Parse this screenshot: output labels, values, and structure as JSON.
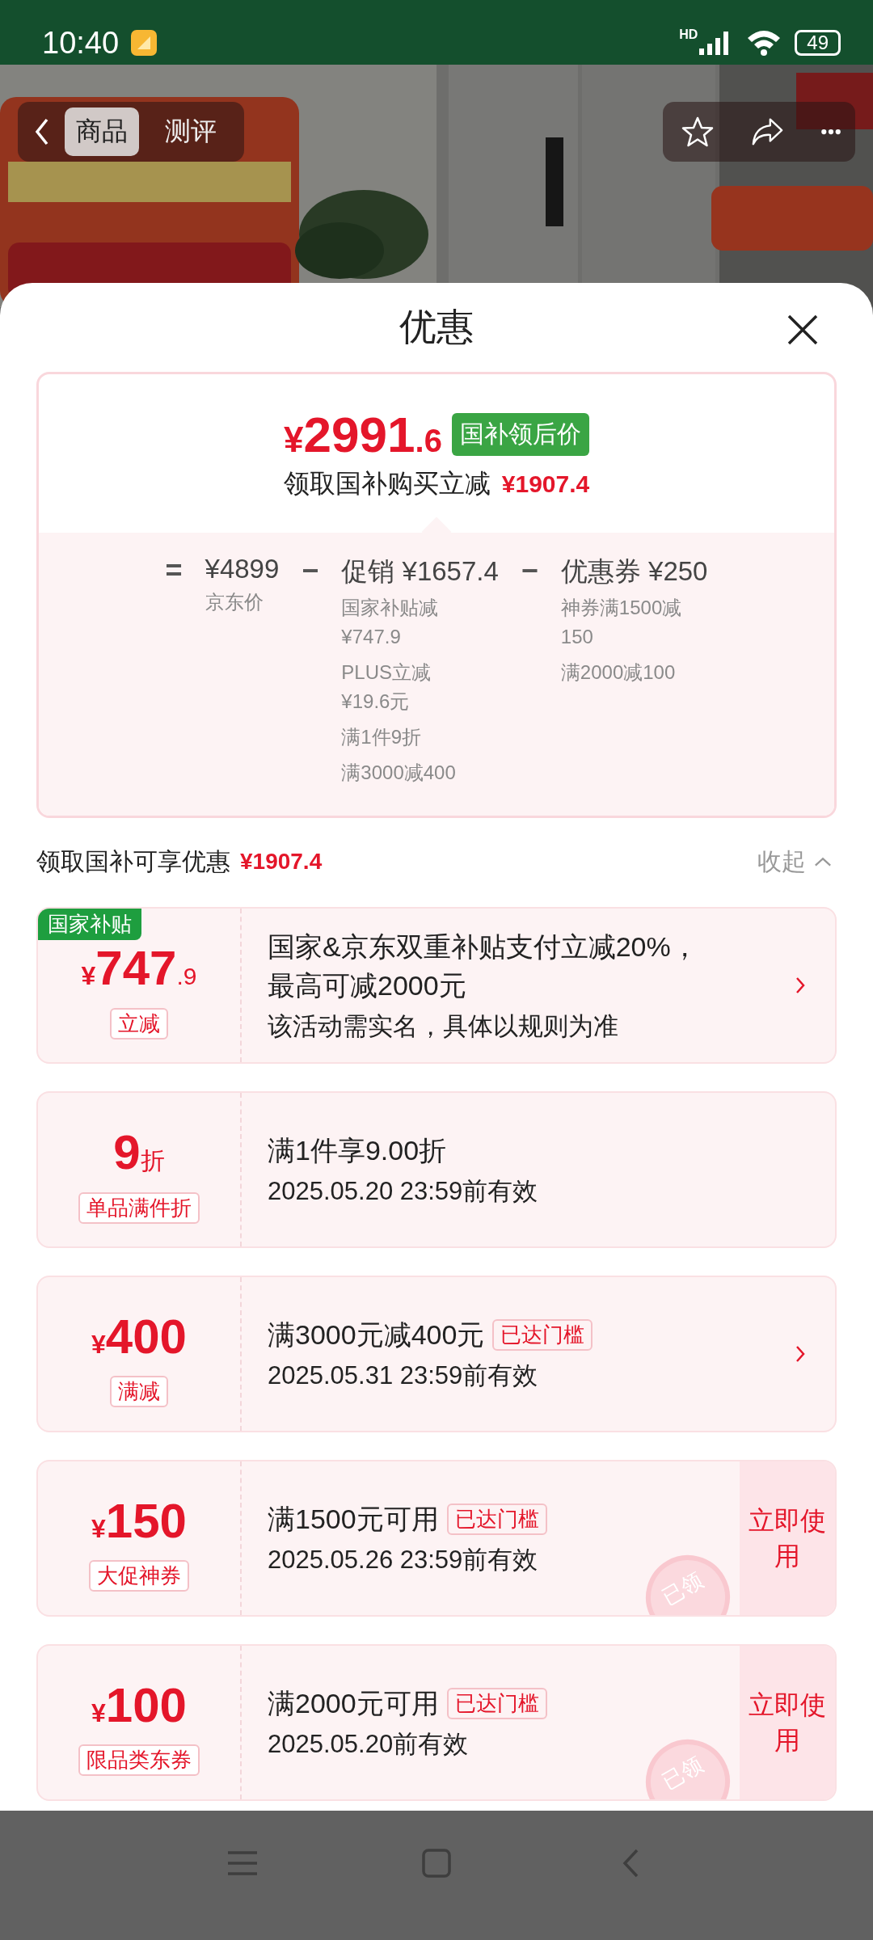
{
  "status_bar": {
    "time": "10:40",
    "network": "HD",
    "battery": "49"
  },
  "top_nav": {
    "tabs": [
      {
        "label": "商品",
        "selected": true
      },
      {
        "label": "测评",
        "selected": false
      }
    ]
  },
  "sheet": {
    "title": "优惠"
  },
  "summary": {
    "price_symbol": "¥",
    "price_integer": "2991",
    "price_decimal": ".6",
    "price_badge": "国补领后价",
    "saving_label": "领取国补购买立减",
    "saving_amount": "¥1907.4",
    "breakdown": [
      {
        "operator": "=",
        "heading": "¥4899",
        "details": [
          "京东价"
        ]
      },
      {
        "operator": "−",
        "heading": "促销 ¥1657.4",
        "details": [
          "国家补贴减¥747.9",
          "PLUS立减¥19.6元",
          "满1件9折",
          "满3000减400"
        ]
      },
      {
        "operator": "−",
        "heading": "优惠券 ¥250",
        "details": [
          "神券满1500减150",
          "满2000减100"
        ]
      }
    ]
  },
  "offers_header": {
    "label": "领取国补可享优惠",
    "amount": "¥1907.4",
    "toggle": "收起",
    "expanded": true
  },
  "coupons": [
    {
      "kind": "arrow",
      "corner_tag": "国家补贴",
      "prefix": "¥",
      "value": "747",
      "suffix": ".9",
      "label": "立减",
      "title": "国家&京东双重补贴支付立减20%，最高可减2000元",
      "subtitle": "该活动需实名，具体以规则为准"
    },
    {
      "kind": "plain",
      "value": "9",
      "suffix": "折",
      "label": "单品满件折",
      "title": "满1件享9.00折",
      "subtitle": "2025.05.20 23:59前有效"
    },
    {
      "kind": "arrow",
      "prefix": "¥",
      "value": "400",
      "label": "满减",
      "title": "满3000元减400元",
      "threshold_badge": "已达门槛",
      "subtitle": "2025.05.31 23:59前有效"
    },
    {
      "kind": "button",
      "prefix": "¥",
      "value": "150",
      "label": "大促神券",
      "title": "满1500元可用",
      "threshold_badge": "已达门槛",
      "subtitle": "2025.05.26 23:59前有效",
      "button": "立即使用",
      "stamp": "已领"
    },
    {
      "kind": "button",
      "prefix": "¥",
      "value": "100",
      "label": "限品类东券",
      "title": "满2000元可用",
      "threshold_badge": "已达门槛",
      "subtitle": "2025.05.20前有效",
      "button": "立即使用",
      "stamp": "已领"
    }
  ]
}
